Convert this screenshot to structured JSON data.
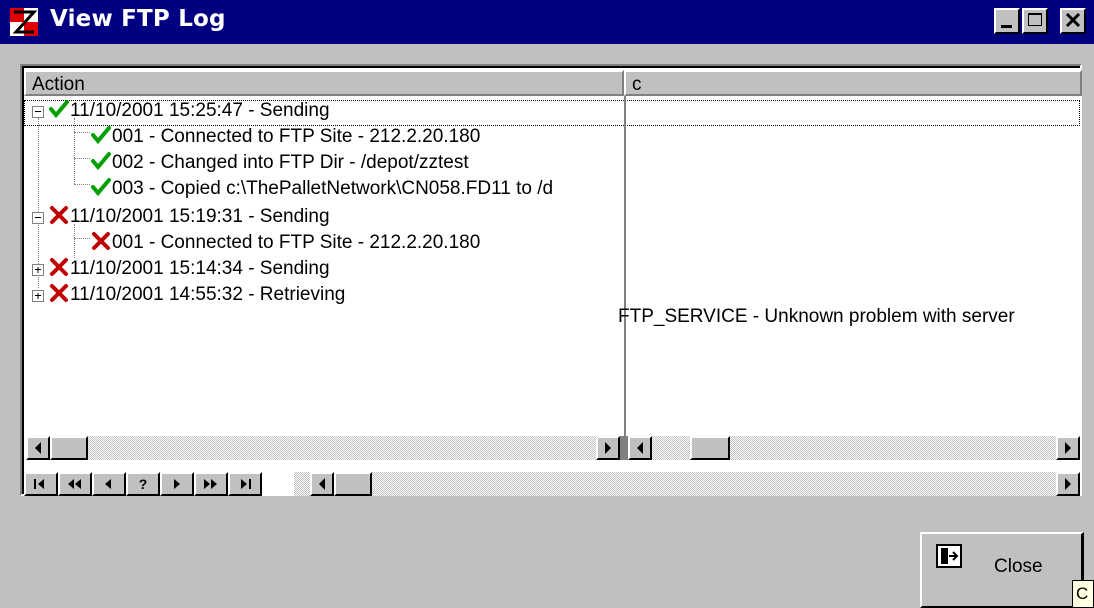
{
  "window": {
    "title": "View FTP Log",
    "app_icon": "app-logo-icon",
    "buttons": [
      "minimize-icon",
      "maximize-icon",
      "close-icon"
    ]
  },
  "columns": [
    "Action",
    "c"
  ],
  "log": [
    {
      "status": "success",
      "expanded": true,
      "text": "11/10/2001 15:25:47 - Sending",
      "children": [
        {
          "status": "success",
          "text": "001 - Connected to FTP Site - 212.2.20.180",
          "detail": ""
        },
        {
          "status": "success",
          "text": "002 - Changed into FTP Dir - /depot/zztest",
          "detail": ""
        },
        {
          "status": "success",
          "text": "003 - Copied c:\\ThePalletNetwork\\CN058.FD11 to /d",
          "detail": ""
        }
      ]
    },
    {
      "status": "error",
      "expanded": true,
      "text": "11/10/2001 15:19:31 - Sending",
      "children": [
        {
          "status": "error",
          "text": "001 - Connected to FTP Site - 212.2.20.180",
          "detail": "FTP_SERVICE - Unknown problem with server"
        }
      ]
    },
    {
      "status": "error",
      "expanded": false,
      "text": "11/10/2001 15:14:34 - Sending",
      "children": []
    },
    {
      "status": "error",
      "expanded": false,
      "text": "11/10/2001 14:55:32 - Retrieving",
      "children": []
    }
  ],
  "navigator": {
    "buttons": [
      "first",
      "prior-page",
      "prior",
      "?",
      "next",
      "next-page",
      "last"
    ]
  },
  "close_button": {
    "label": "Close",
    "icon": "exit-door-icon"
  },
  "tooltip": "C",
  "colors": {
    "titlebar": "#000080",
    "face": "#c0c0c0",
    "success": "#00a000",
    "error": "#c00000"
  }
}
